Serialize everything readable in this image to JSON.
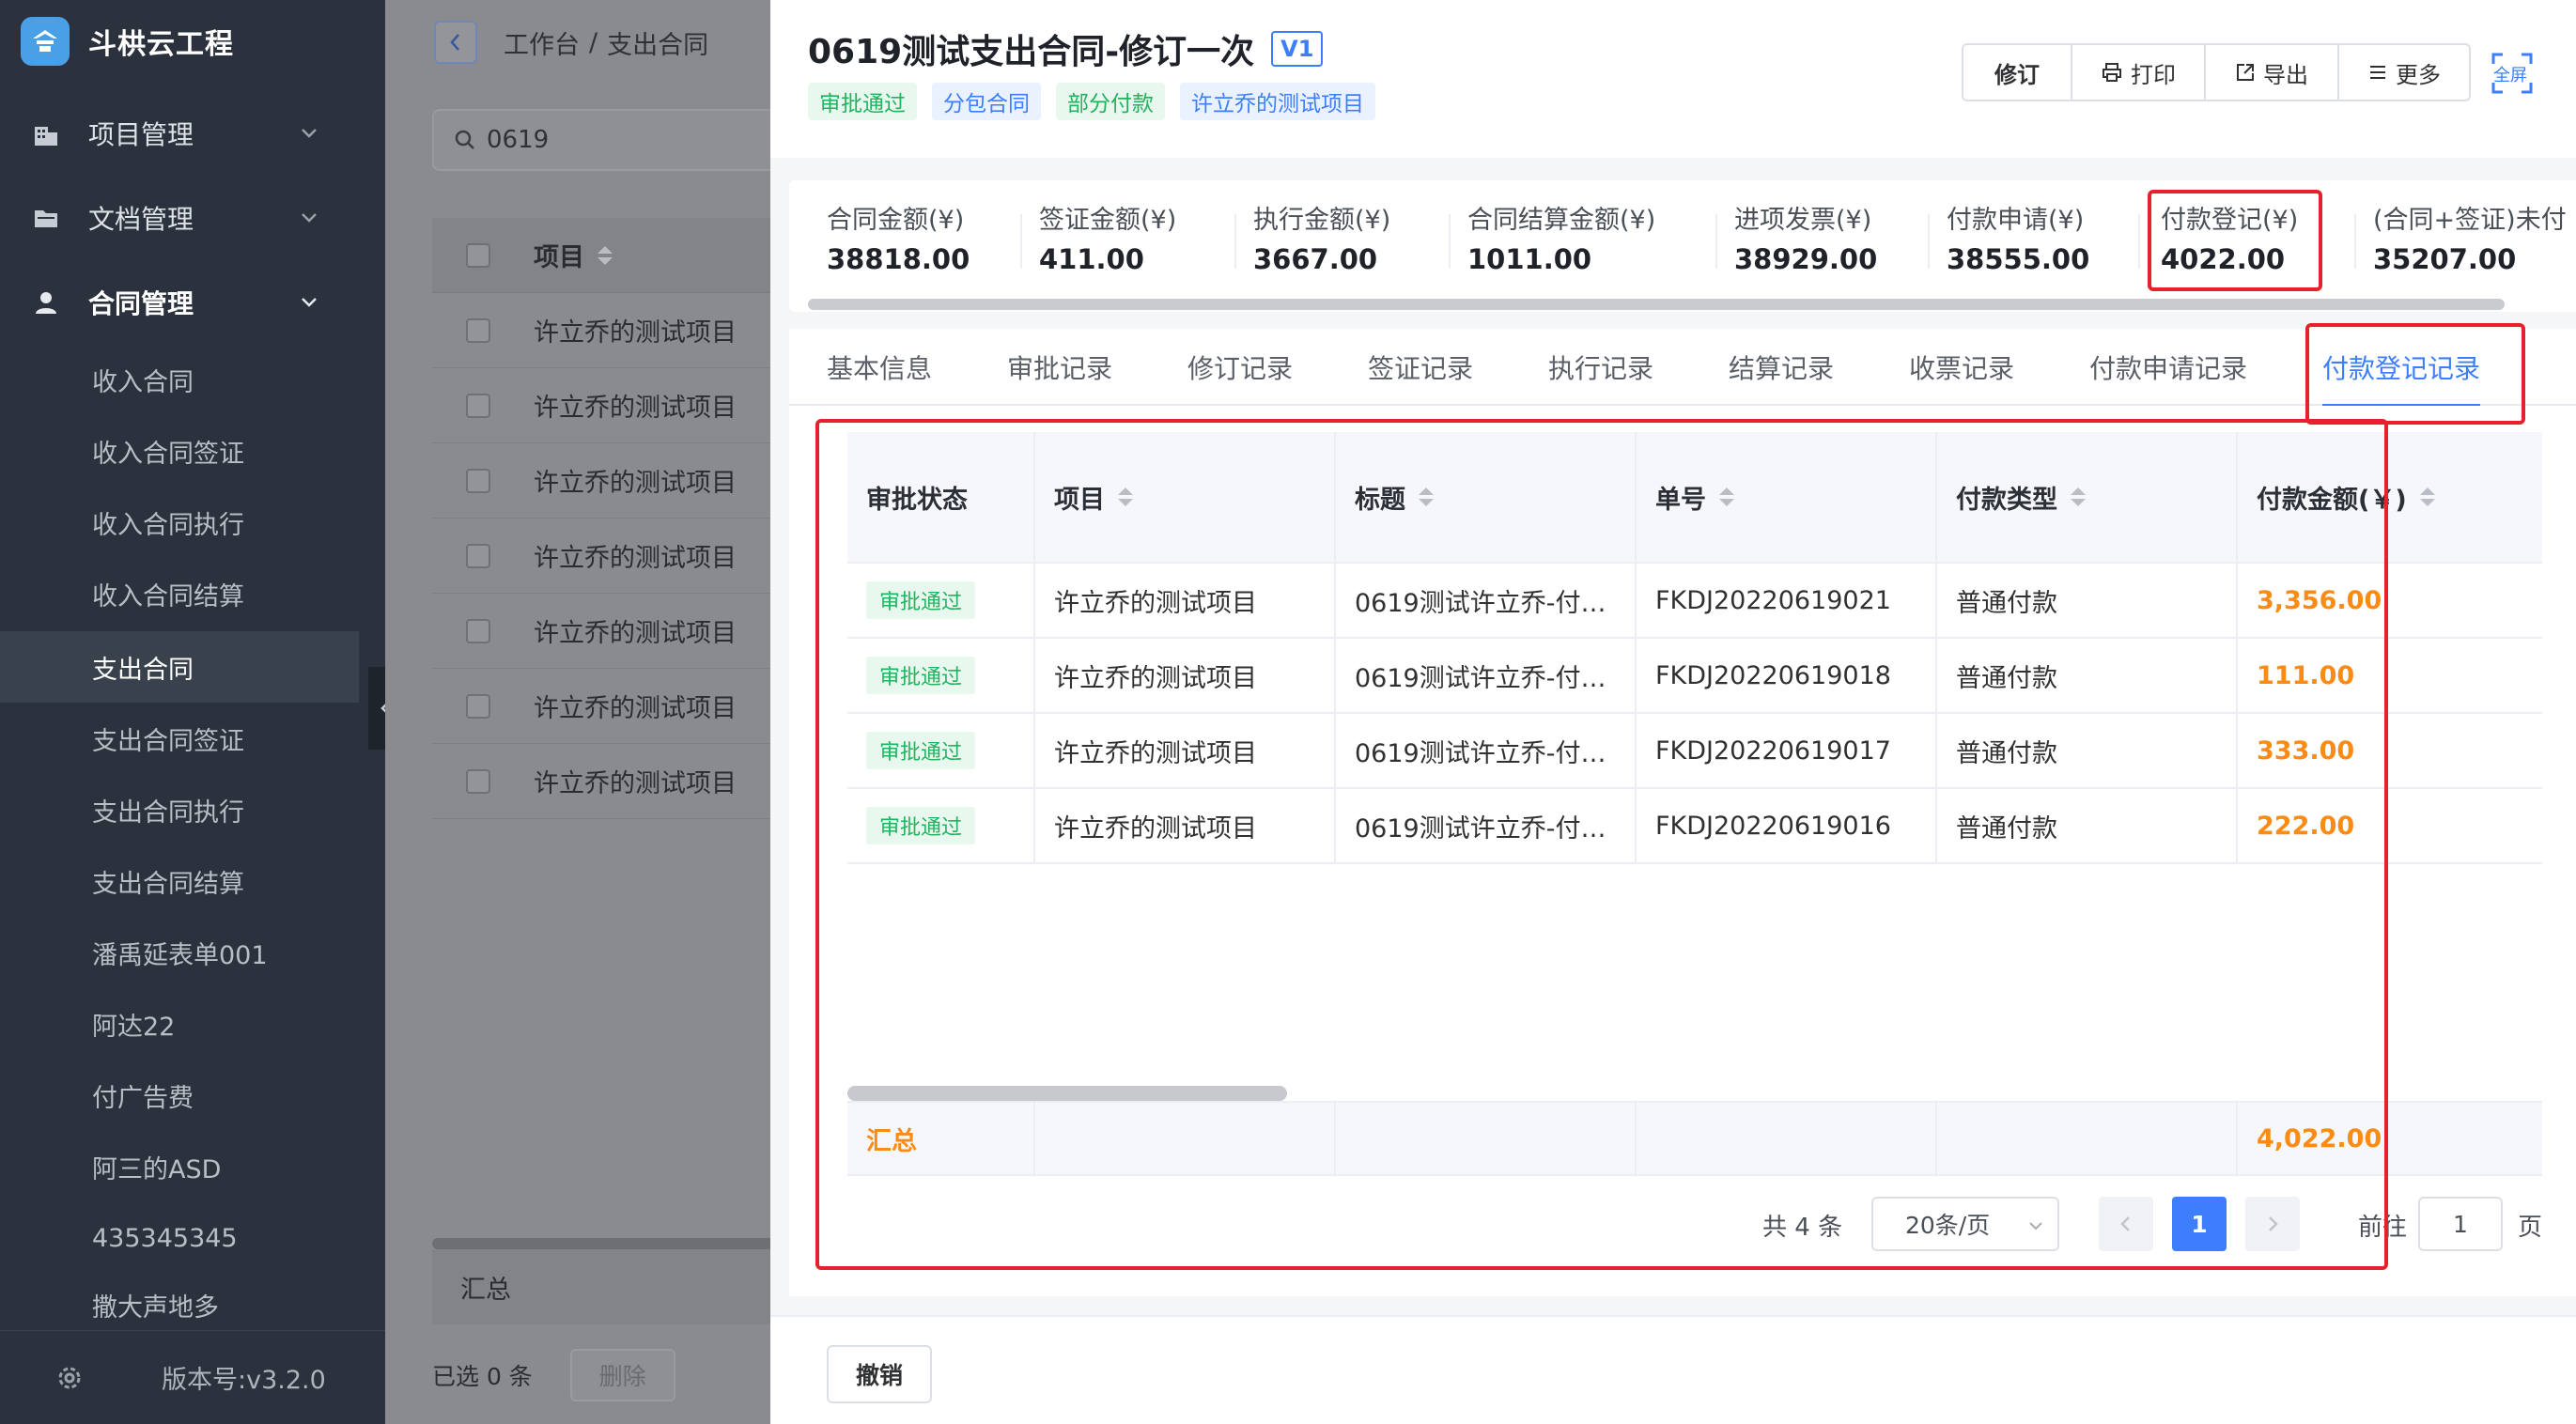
{
  "app": {
    "name": "斗栱云工程",
    "version": "版本号:v3.2.0"
  },
  "sidebar": {
    "top_menus": [
      {
        "label": "项目管理",
        "icon": "building-icon"
      },
      {
        "label": "文档管理",
        "icon": "folder-icon"
      },
      {
        "label": "合同管理",
        "icon": "user-icon"
      }
    ],
    "sub_items": [
      "收入合同",
      "收入合同签证",
      "收入合同执行",
      "收入合同结算",
      "支出合同",
      "支出合同签证",
      "支出合同执行",
      "支出合同结算",
      "潘禹延表单001",
      "阿达22",
      "付广告费",
      "阿三的ASD",
      "435345345",
      "撒大声地多"
    ],
    "active_sub": "支出合同"
  },
  "background": {
    "breadcrumb": {
      "home": "工作台",
      "separator": "/",
      "current": "支出合同"
    },
    "search_value": "0619",
    "column_project": "项目",
    "rows": [
      "许立乔的测试项目",
      "许立乔的测试项目",
      "许立乔的测试项目",
      "许立乔的测试项目",
      "许立乔的测试项目",
      "许立乔的测试项目",
      "许立乔的测试项目"
    ],
    "summary_label": "汇总",
    "selected_text": "已选 0 条",
    "delete_label": "删除"
  },
  "drawer": {
    "title": "0619测试支出合同-修订一次",
    "version_badge": "V1",
    "tags": [
      {
        "label": "审批通过",
        "color": "green"
      },
      {
        "label": "分包合同",
        "color": "blue"
      },
      {
        "label": "部分付款",
        "color": "green"
      },
      {
        "label": "许立乔的测试项目",
        "color": "blue"
      }
    ],
    "actions": {
      "revise": "修订",
      "print": "打印",
      "export": "导出",
      "more": "更多"
    },
    "fullscreen_label": "全屏",
    "stats": [
      {
        "label": "合同金额(¥)",
        "value": "38818.00"
      },
      {
        "label": "签证金额(¥)",
        "value": "411.00"
      },
      {
        "label": "执行金额(¥)",
        "value": "3667.00"
      },
      {
        "label": "合同结算金额(¥)",
        "value": "1011.00"
      },
      {
        "label": "进项发票(¥)",
        "value": "38929.00"
      },
      {
        "label": "付款申请(¥)",
        "value": "38555.00"
      },
      {
        "label": "付款登记(¥)",
        "value": "4022.00"
      },
      {
        "label": "(合同+签证)未付",
        "value": "35207.00"
      }
    ],
    "tabs": [
      "基本信息",
      "审批记录",
      "修订记录",
      "签证记录",
      "执行记录",
      "结算记录",
      "收票记录",
      "付款申请记录",
      "付款登记记录"
    ],
    "active_tab": "付款登记记录",
    "table": {
      "columns": [
        "审批状态",
        "项目",
        "标题",
        "单号",
        "付款类型",
        "付款金额(￥)"
      ],
      "rows": [
        {
          "status": "审批通过",
          "project": "许立乔的测试项目",
          "title": "0619测试许立乔-付…",
          "no": "FKDJ20220619021",
          "type": "普通付款",
          "amount": "3,356.00"
        },
        {
          "status": "审批通过",
          "project": "许立乔的测试项目",
          "title": "0619测试许立乔-付…",
          "no": "FKDJ20220619018",
          "type": "普通付款",
          "amount": "111.00"
        },
        {
          "status": "审批通过",
          "project": "许立乔的测试项目",
          "title": "0619测试许立乔-付…",
          "no": "FKDJ20220619017",
          "type": "普通付款",
          "amount": "333.00"
        },
        {
          "status": "审批通过",
          "project": "许立乔的测试项目",
          "title": "0619测试许立乔-付…",
          "no": "FKDJ20220619016",
          "type": "普通付款",
          "amount": "222.00"
        }
      ],
      "summary_label": "汇总",
      "summary_amount": "4,022.00"
    },
    "pagination": {
      "total": "共 4 条",
      "page_size": "20条/页",
      "current_page": "1",
      "goto_label": "前往",
      "goto_value": "1",
      "page_suffix": "页"
    },
    "cancel_label": "撤销"
  },
  "colors": {
    "accent": "#3d7eff",
    "success": "#22b35e",
    "amount": "#fa8c16",
    "highlight": "#e8202b",
    "sidebar": "#2b323d"
  }
}
